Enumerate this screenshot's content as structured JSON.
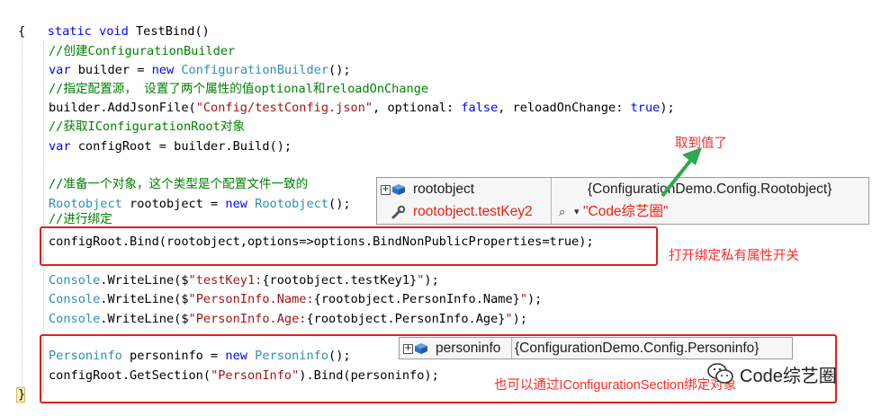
{
  "editor": {
    "header": [
      "static void TestBind()"
    ],
    "open_brace": "{",
    "comment_create": "//创建ConfigurationBuilder",
    "builder_decl": {
      "kw_var": "var",
      "mid": " builder = ",
      "kw_new": "new",
      "type": " ConfigurationBuilder",
      "tail": "();"
    },
    "comment_source": "//指定配置源， 设置了两个属性的值optional和reloadOnChange",
    "addjson": {
      "pre": "builder.AddJsonFile(",
      "str": "\"Config/testConfig.json\"",
      "mid1": ", optional: ",
      "false": "false",
      "mid2": ", reloadOnChange: ",
      "true": "true",
      "tail": ");"
    },
    "comment_getroot": "//获取IConfigurationRoot对象",
    "root_decl": {
      "kw_var": "var",
      "rest": " configRoot = builder.Build();"
    },
    "comment_prepare": "//准备一个对象，这个类型是个配置文件一致的",
    "rootobj_decl": {
      "type": "Rootobject",
      "mid": " rootobject = ",
      "kw_new": "new",
      "type2": " Rootobject",
      "tail": "();"
    },
    "comment_bind": "//进行绑定",
    "bind_line": "configRoot.Bind(rootobject,options=>options.BindNonPublicProperties=true);",
    "wl1": {
      "type": "Console",
      "pre": ".WriteLine($",
      "str1": "\"testKey1:",
      "interp": "{rootobject.testKey1}",
      "str2": "\"",
      "tail": ");"
    },
    "wl2": {
      "type": "Console",
      "pre": ".WriteLine($",
      "str1": "\"PersonInfo.Name:",
      "interp": "{rootobject.PersonInfo.Name}",
      "str2": "\"",
      "tail": ");"
    },
    "wl3": {
      "type": "Console",
      "pre": ".WriteLine($",
      "str1": "\"PersonInfo.Age:",
      "interp": "{rootobject.PersonInfo.Age}",
      "str2": "\"",
      "tail": ");"
    },
    "personinfo_decl": {
      "type": "Personinfo",
      "mid": " personinfo = ",
      "kw_new": "new",
      "type2": " Personinfo",
      "tail": "();"
    },
    "getsection": {
      "pre": "configRoot.GetSection(",
      "str": "\"PersonInfo\"",
      "tail": ").Bind(personinfo);"
    },
    "close_brace": "}"
  },
  "tooltip_root": {
    "expander": "+",
    "name": "rootobject",
    "value": "{ConfigurationDemo.Config.Rootobject}",
    "child_name": "rootobject.testKey2",
    "child_value": "\"Code综艺圈\"",
    "magnifier": "⌕",
    "dropdown": "▾"
  },
  "tooltip_person": {
    "expander": "+",
    "name": "personinfo",
    "value": "{ConfigurationDemo.Config.Personinfo}"
  },
  "annotations": {
    "got_value": "取到值了",
    "bind_private": "打开绑定私有属性开关",
    "section_bind": "也可以通过IConfigurationSection绑定对象"
  },
  "watermark": {
    "text": "Code综艺圈",
    "icon": "wechat-icon"
  },
  "colors": {
    "keyword": "#0000ff",
    "type": "#2b91af",
    "comment": "#008000",
    "string": "#a31515",
    "annotation_red": "#ff2a2a",
    "arrow_green": "#2fa84f"
  }
}
